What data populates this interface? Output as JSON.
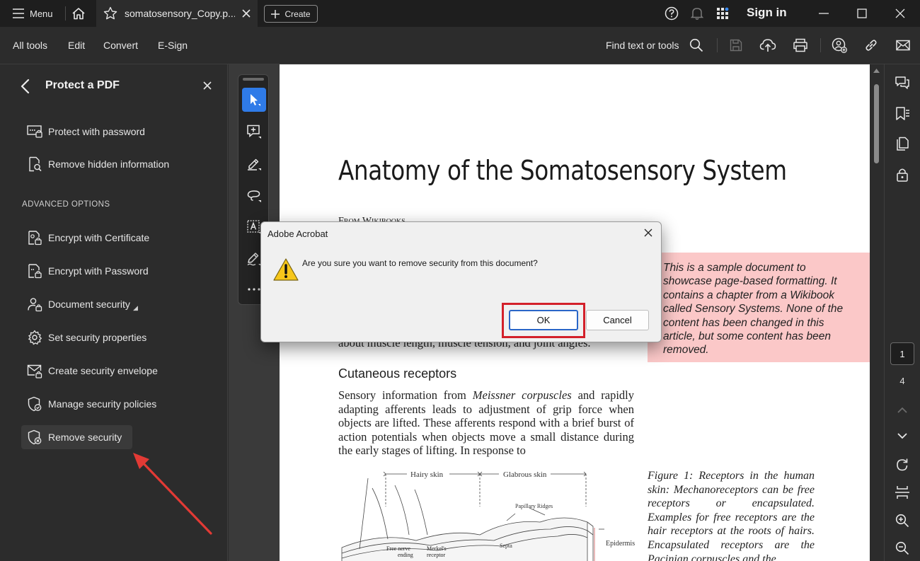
{
  "titlebar": {
    "menu_label": "Menu",
    "tab_name": "somatosensory_Copy.p...",
    "create_label": "Create",
    "sign_in": "Sign in"
  },
  "menubar": {
    "items": [
      "All tools",
      "Edit",
      "Convert",
      "E-Sign"
    ],
    "find_label": "Find text or tools"
  },
  "left_panel": {
    "title": "Protect a PDF",
    "items": [
      {
        "label": "Protect with password",
        "icon": "password-icon"
      },
      {
        "label": "Remove hidden information",
        "icon": "document-search-icon"
      }
    ],
    "section_label": "ADVANCED OPTIONS",
    "advanced_items": [
      {
        "label": "Encrypt with Certificate",
        "icon": "certificate-lock-icon"
      },
      {
        "label": "Encrypt with Password",
        "icon": "password-lock-icon"
      },
      {
        "label": "Document security",
        "icon": "user-lock-icon"
      },
      {
        "label": "Set security properties",
        "icon": "gear-icon"
      },
      {
        "label": "Create security envelope",
        "icon": "envelope-lock-icon"
      },
      {
        "label": "Manage security policies",
        "icon": "shield-check-icon"
      },
      {
        "label": "Remove security",
        "icon": "shield-remove-icon"
      }
    ]
  },
  "document": {
    "title": "Anatomy of the Somatosensory System",
    "from_line": "From Wikibooks",
    "callout": "This is a sample document to showcase page-based formatting. It contains a chapter from a Wikibook called Sensory Systems. None of the content has been changed in this article, but some content has been removed.",
    "partial_line": "about muscle length, muscle tension, and joint angles.",
    "heading": "Cutaneous receptors",
    "para_start": "Sensory information from ",
    "para_em": "Meissner corpuscles",
    "para_rest": " and rapidly adapting afferents leads to adjustment of grip force when objects are lifted. These afferents respond with a brief burst of action potentials when objects move a small distance during the early stages of lifting. In response to",
    "caption": "Figure 1: Receptors in the human skin: Mechanoreceptors can be free receptors or encapsulated. Examples for free receptors are the hair receptors at the roots of hairs. Encapsulated receptors are the Pacinian corpuscles and the",
    "figure_labels": {
      "hairy": "Hairy skin",
      "glabrous": "Glabrous skin",
      "papillary": "Papillary Ridges",
      "septa": "Septa",
      "epidermis": "Epidermis",
      "free_nerve_1": "Free nerve",
      "free_nerve_2": "ending",
      "merkel_1": "Merkel's",
      "merkel_2": "receptor"
    }
  },
  "page_nav": {
    "current": "1",
    "total": "4"
  },
  "dialog": {
    "title": "Adobe Acrobat",
    "message": "Are you sure you want to remove security from this document?",
    "ok_label": "OK",
    "cancel_label": "Cancel"
  },
  "colors": {
    "highlight": "#d3202a",
    "accent": "#2f7be8",
    "callout_bg": "#fbc8c8"
  }
}
